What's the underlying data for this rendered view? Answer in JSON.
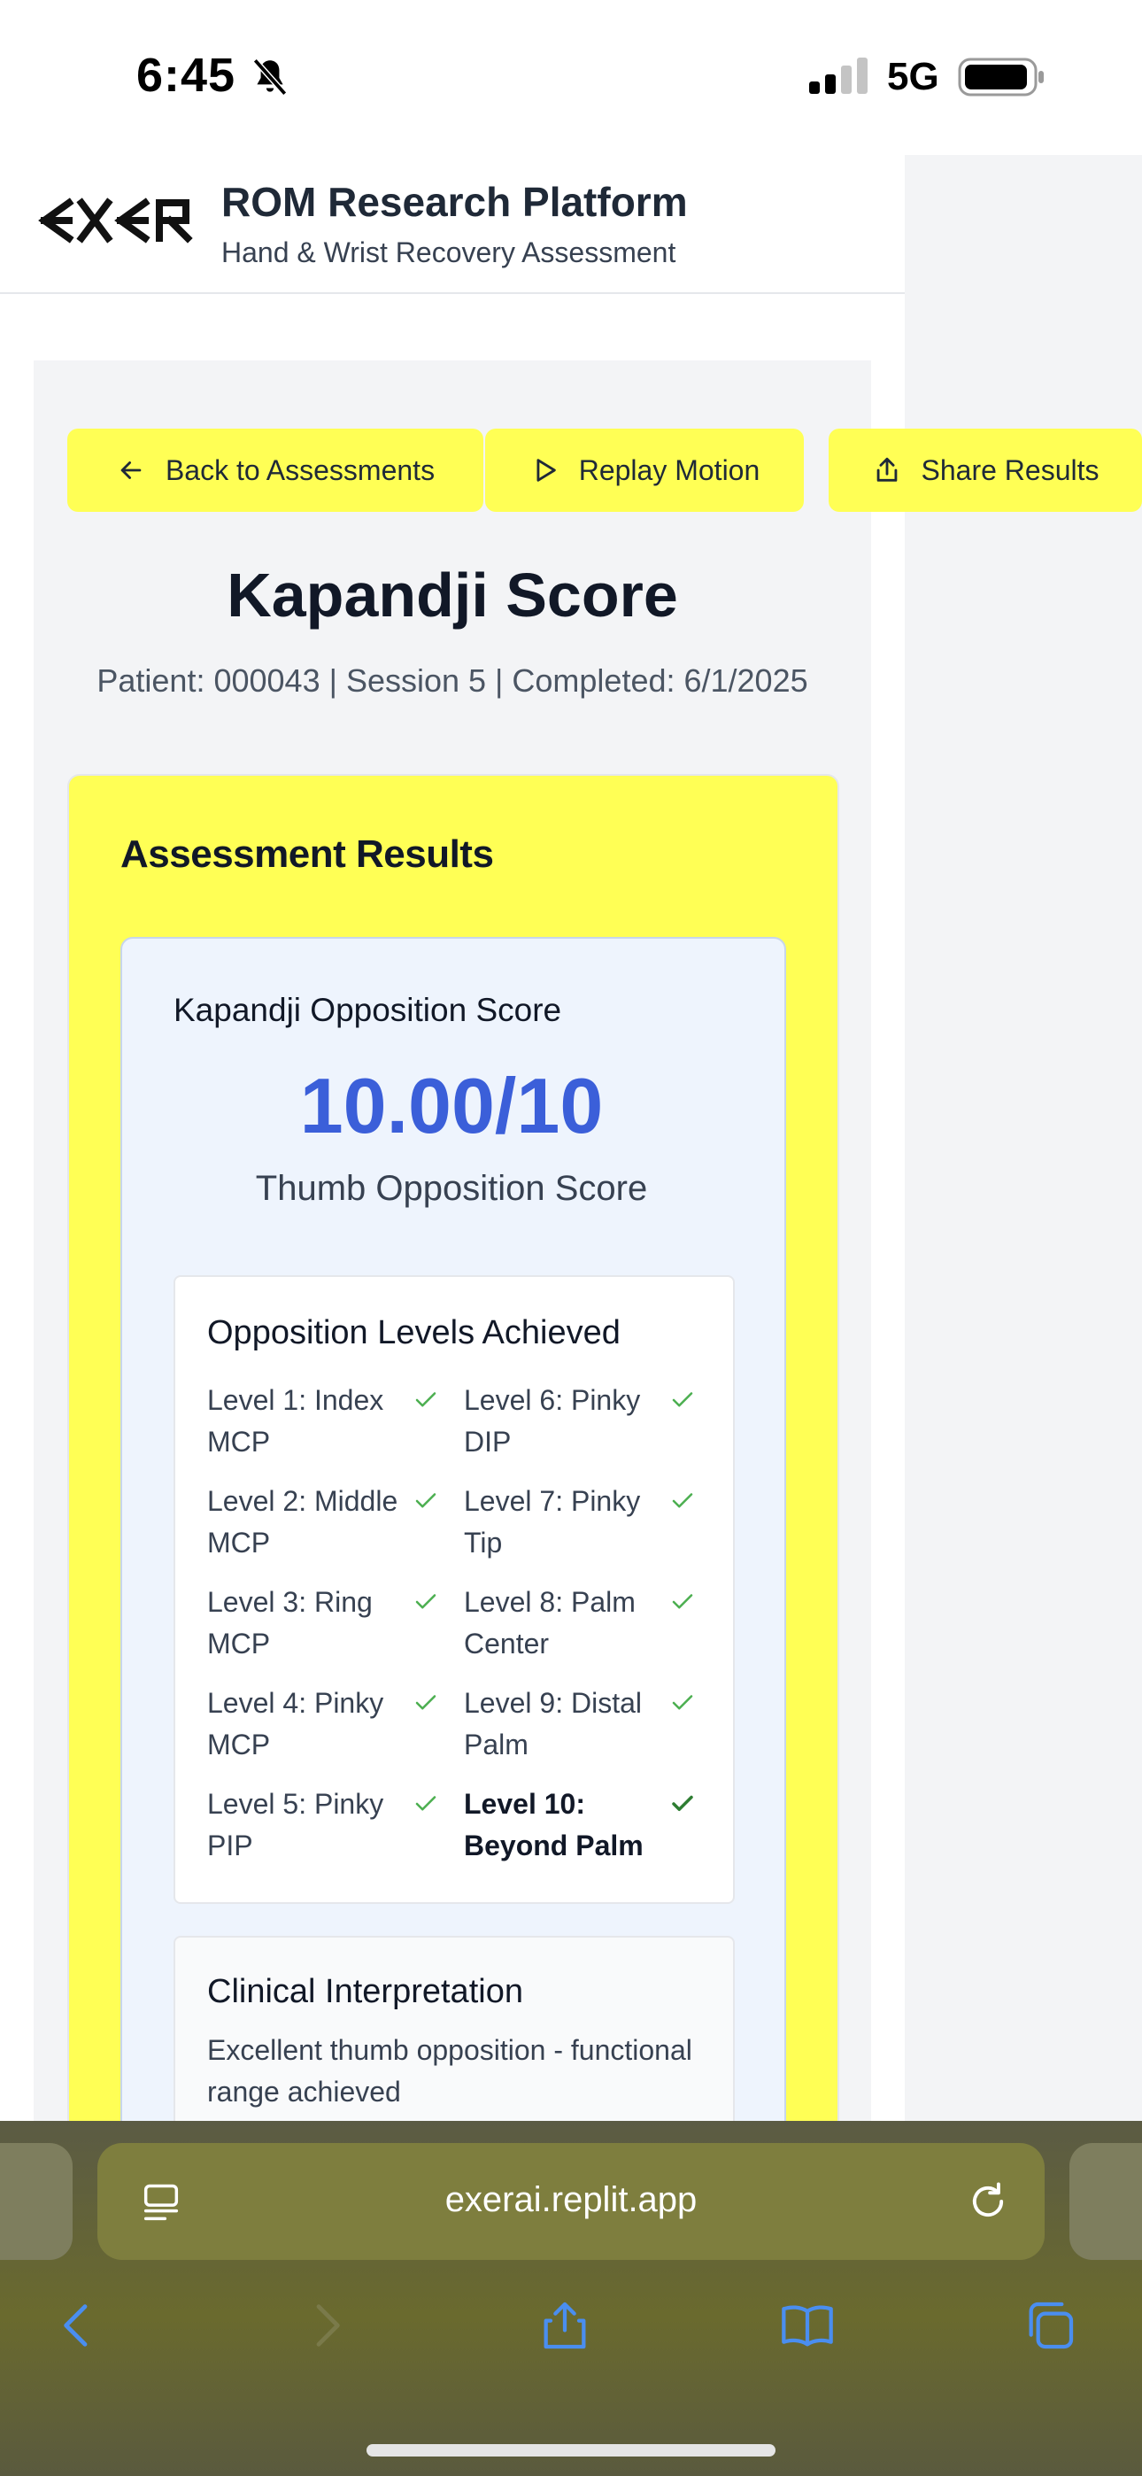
{
  "status": {
    "time": "6:45",
    "network": "5G"
  },
  "header": {
    "title": "ROM Research Platform",
    "subtitle": "Hand & Wrist Recovery Assessment"
  },
  "actions": {
    "back": "Back to Assessments",
    "replay": "Replay Motion",
    "share": "Share Results"
  },
  "page": {
    "title": "Kapandji Score",
    "meta": "Patient: 000043 | Session 5 | Completed: 6/1/2025"
  },
  "results": {
    "heading": "Assessment Results",
    "score_label": "Kapandji Opposition Score",
    "score_value": "10.00/10",
    "score_caption": "Thumb Opposition Score",
    "levels_heading": "Opposition Levels Achieved",
    "levels": [
      {
        "label": "Level 1: Index MCP",
        "achieved": true
      },
      {
        "label": "Level 2: Middle MCP",
        "achieved": true
      },
      {
        "label": "Level 3: Ring MCP",
        "achieved": true
      },
      {
        "label": "Level 4: Pinky MCP",
        "achieved": true
      },
      {
        "label": "Level 5: Pinky PIP",
        "achieved": true
      },
      {
        "label": "Level 6: Pinky DIP",
        "achieved": true
      },
      {
        "label": "Level 7: Pinky Tip",
        "achieved": true
      },
      {
        "label": "Level 8: Palm Center",
        "achieved": true
      },
      {
        "label": "Level 9: Distal Palm",
        "achieved": true
      },
      {
        "label": "Level 10: Beyond Palm",
        "achieved": true
      }
    ],
    "interpretation_heading": "Clinical Interpretation",
    "interpretation_text": "Excellent thumb opposition - functional range achieved"
  },
  "browser": {
    "url": "exerai.replit.app"
  },
  "colors": {
    "accent": "#ffff55",
    "score": "#3b5fd9",
    "check": "#4caf50"
  }
}
